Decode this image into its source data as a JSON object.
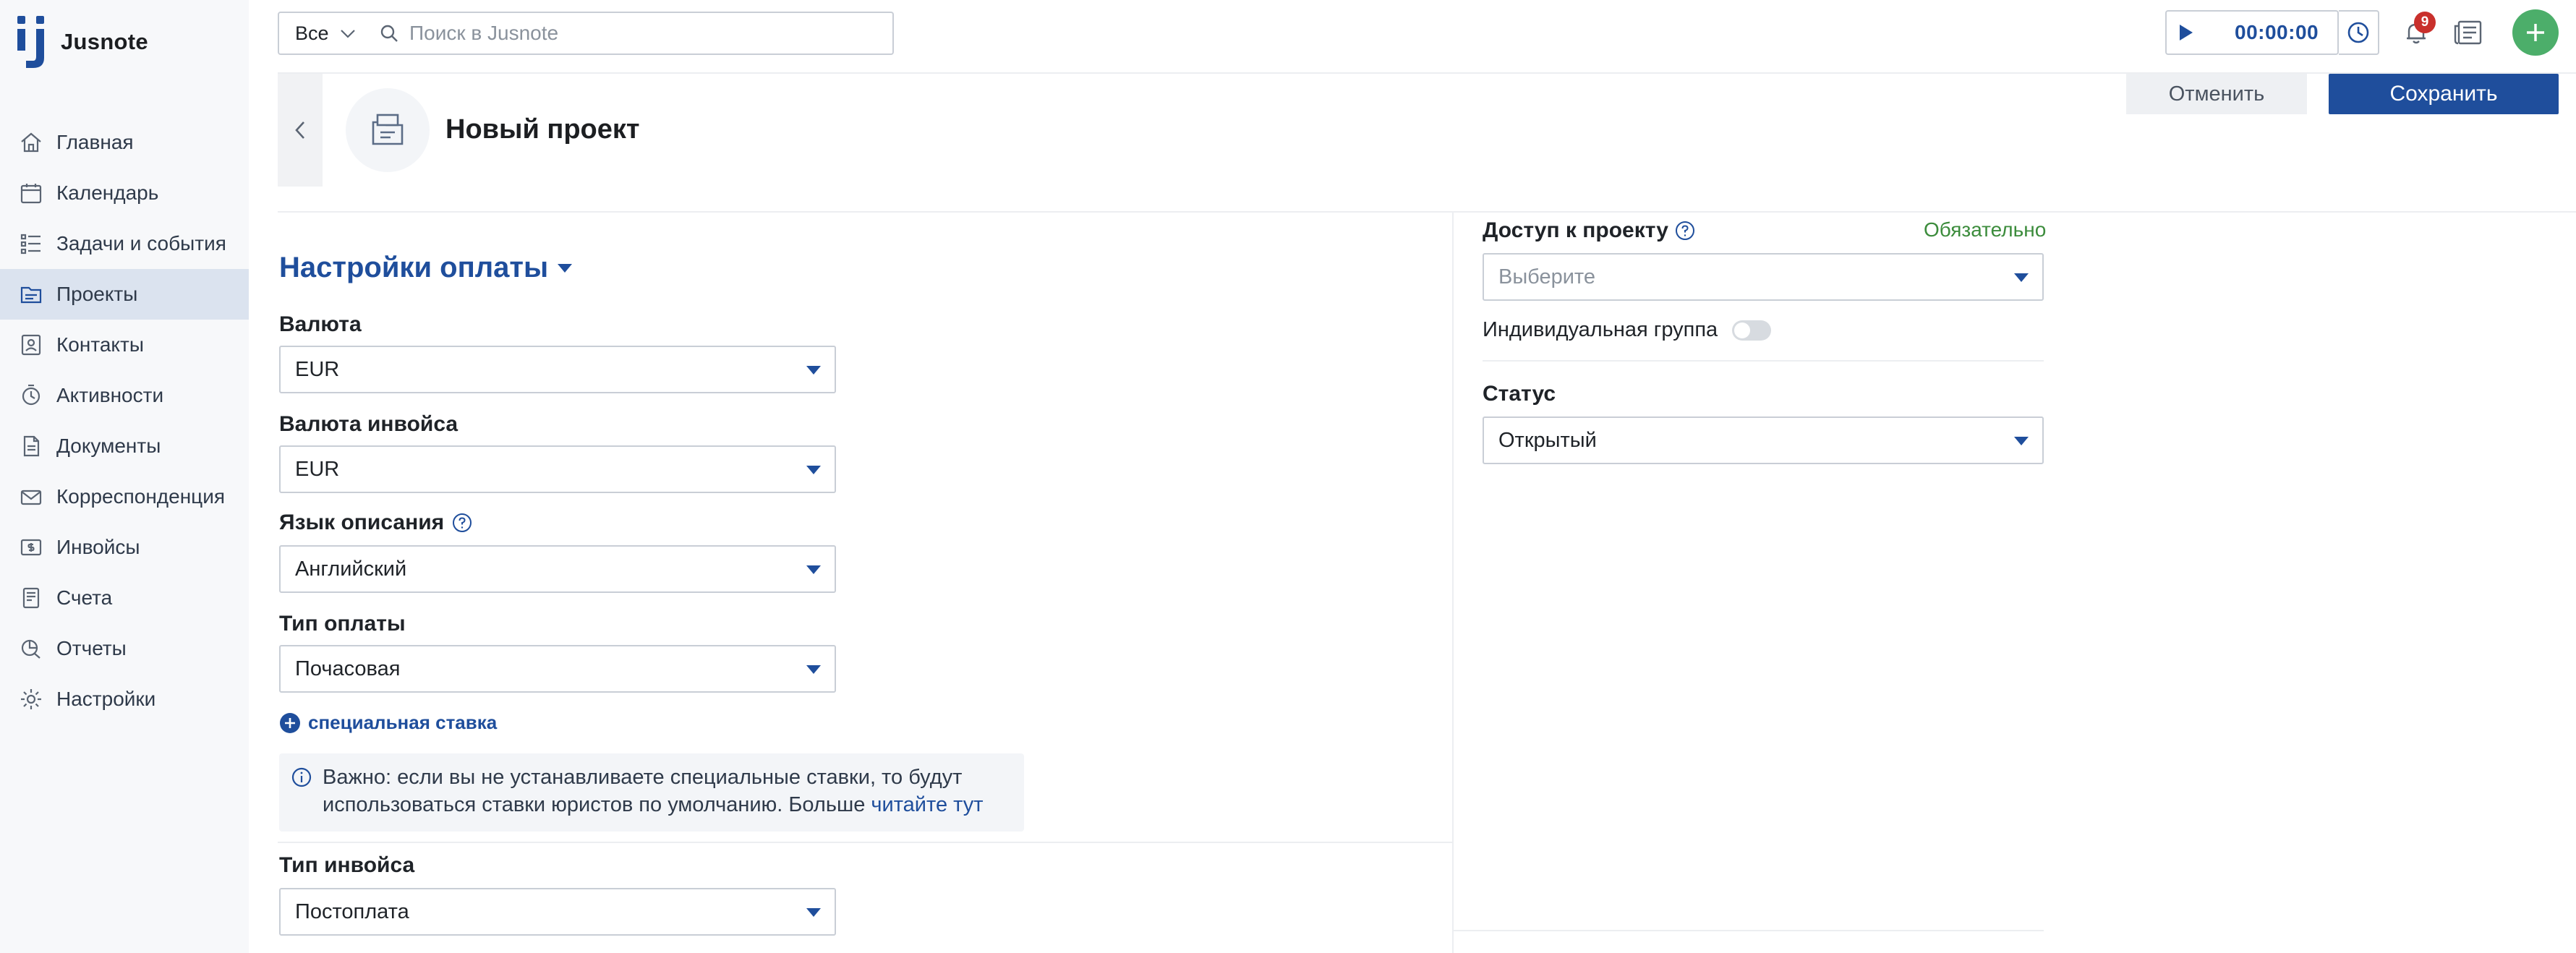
{
  "app": {
    "brand": "Jusnote"
  },
  "sidebar": {
    "items": [
      {
        "label": "Главная",
        "icon": "home-icon"
      },
      {
        "label": "Календарь",
        "icon": "calendar-icon"
      },
      {
        "label": "Задачи и события",
        "icon": "tasks-icon"
      },
      {
        "label": "Проекты",
        "icon": "projects-icon",
        "active": true
      },
      {
        "label": "Контакты",
        "icon": "contacts-icon"
      },
      {
        "label": "Активности",
        "icon": "activities-icon"
      },
      {
        "label": "Документы",
        "icon": "documents-icon"
      },
      {
        "label": "Корреспонденция",
        "icon": "correspondence-icon"
      },
      {
        "label": "Инвойсы",
        "icon": "invoices-icon"
      },
      {
        "label": "Счета",
        "icon": "accounts-icon"
      },
      {
        "label": "Отчеты",
        "icon": "reports-icon"
      },
      {
        "label": "Настройки",
        "icon": "settings-icon"
      }
    ]
  },
  "topbar": {
    "scope": "Все",
    "search_placeholder": "Поиск в Jusnote",
    "timer": "00:00:00",
    "notifications_count": "9"
  },
  "header": {
    "title": "Новый проект",
    "cancel_label": "Отменить",
    "save_label": "Сохранить"
  },
  "payment": {
    "section_title": "Настройки оплаты",
    "currency": {
      "label": "Валюта",
      "value": "EUR"
    },
    "invoice_currency": {
      "label": "Валюта инвойса",
      "value": "EUR"
    },
    "description_language": {
      "label": "Язык описания",
      "value": "Английский"
    },
    "payment_type": {
      "label": "Тип оплаты",
      "value": "Почасовая"
    },
    "special_rate_label": "специальная ставка",
    "notice_text": "Важно: если вы не устанавливаете специальные ставки, то будут использоваться ставки юристов по умолчанию. Больше ",
    "notice_link": "читайте тут",
    "invoice_type": {
      "label": "Тип инвойса",
      "value": "Постоплата"
    }
  },
  "access": {
    "label": "Доступ к проекту",
    "required": "Обязательно",
    "placeholder": "Выберите",
    "individual_group_label": "Индивидуальная группа",
    "individual_group_enabled": false
  },
  "status": {
    "label": "Статус",
    "value": "Открытый"
  },
  "colors": {
    "accent": "#1f4e9c",
    "success": "#4cae6a",
    "badge": "#c9302c",
    "required": "#3c8c3c"
  }
}
